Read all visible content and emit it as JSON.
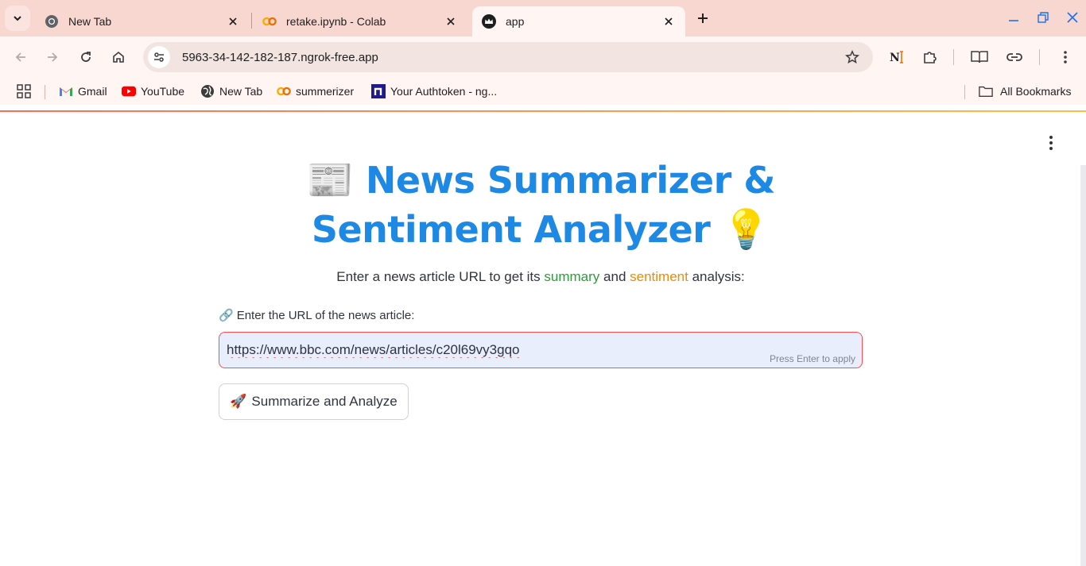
{
  "browser": {
    "tabs": [
      {
        "title": "New Tab",
        "favicon": "chrome-icon",
        "active": false
      },
      {
        "title": "retake.ipynb - Colab",
        "favicon": "colab-icon",
        "active": false
      },
      {
        "title": "app",
        "favicon": "streamlit-crown-icon",
        "active": true
      }
    ],
    "address": "5963-34-142-182-187.ngrok-free.app",
    "bookmarks": [
      {
        "label": "Gmail",
        "icon": "gmail-icon"
      },
      {
        "label": "YouTube",
        "icon": "youtube-icon"
      },
      {
        "label": "New Tab",
        "icon": "globe-icon"
      },
      {
        "label": "summerizer",
        "icon": "colab-icon"
      },
      {
        "label": "Your Authtoken - ng...",
        "icon": "ngrok-icon"
      }
    ],
    "all_bookmarks": "All Bookmarks"
  },
  "app": {
    "heading_emoji_left": "📰",
    "heading_text": "News Summarizer & Sentiment Analyzer",
    "heading_emoji_right": "💡",
    "intro": {
      "prefix": "Enter a news article URL to get its",
      "summary": "summary",
      "and": "and",
      "sentiment": "sentiment",
      "suffix": "analysis:"
    },
    "input_label_icon": "🔗",
    "input_label": "Enter the URL of the news article:",
    "input_value": "https://www.bbc.com/news/articles/c20l69vy3gqo",
    "input_hint": "Press Enter to apply",
    "button_icon": "🚀",
    "button_label": "Summarize and Analyze"
  },
  "colors": {
    "title_blue": "#1e88e5",
    "summary_green": "#2e9b3a",
    "sentiment_orange": "#f08a00",
    "input_border_red": "#ff4b4b",
    "tabstrip_bg": "#f9d7d1"
  }
}
